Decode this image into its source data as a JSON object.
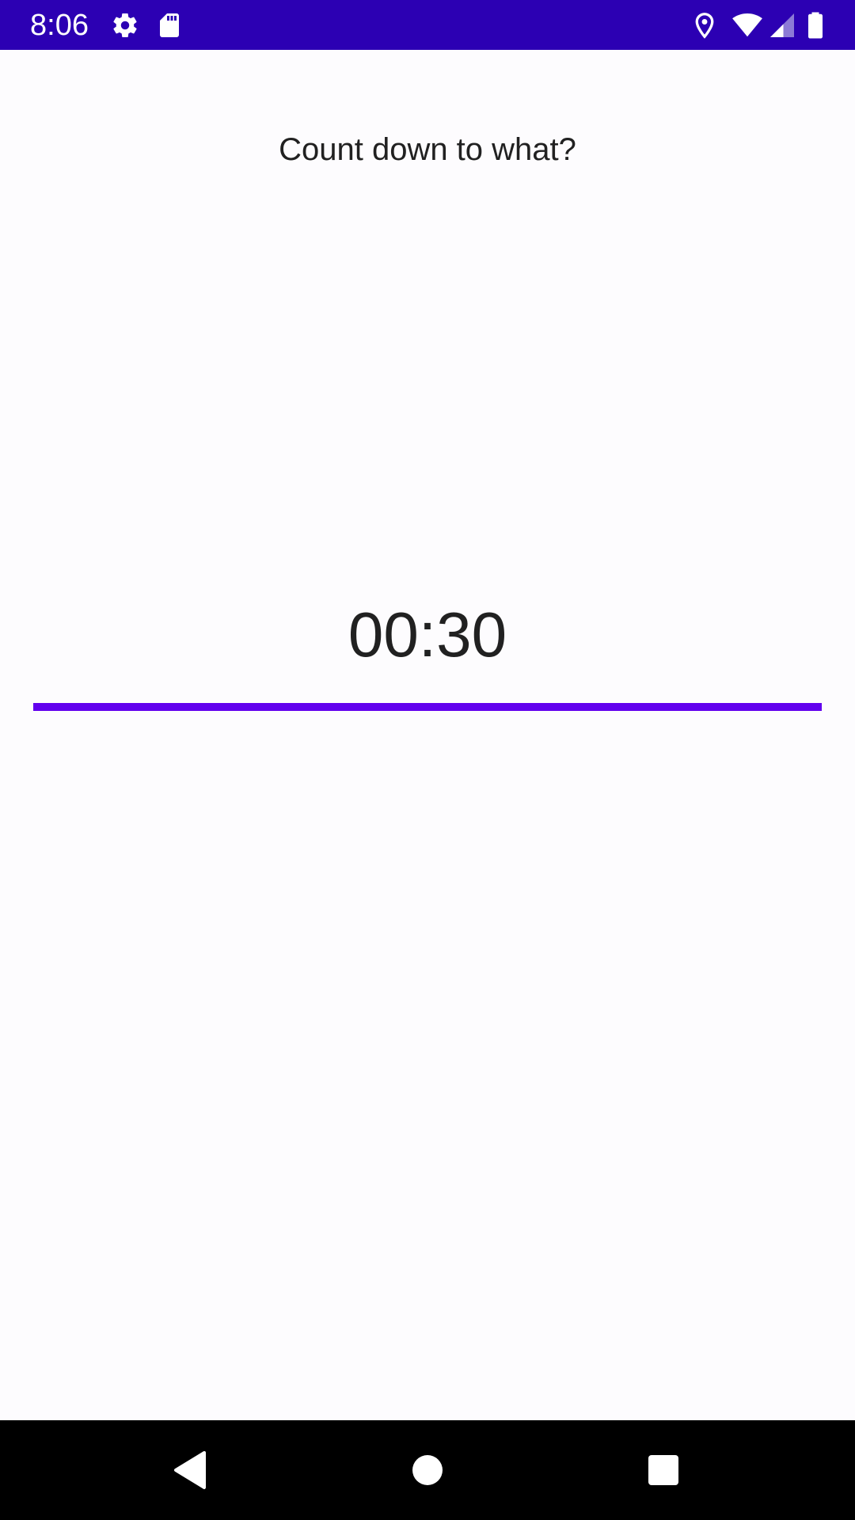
{
  "status_bar": {
    "time": "8:06",
    "icons": [
      "settings-icon",
      "sd-card-icon",
      "location-icon",
      "wifi-icon",
      "cell-signal-icon",
      "battery-icon"
    ],
    "background": "#2c00b3"
  },
  "main": {
    "prompt": "Count down to what?",
    "timer": "00:30",
    "progress_fraction": 1.0,
    "accent_color": "#6200ee"
  },
  "nav_bar": {
    "buttons": [
      "back-icon",
      "home-icon",
      "recents-icon"
    ]
  }
}
